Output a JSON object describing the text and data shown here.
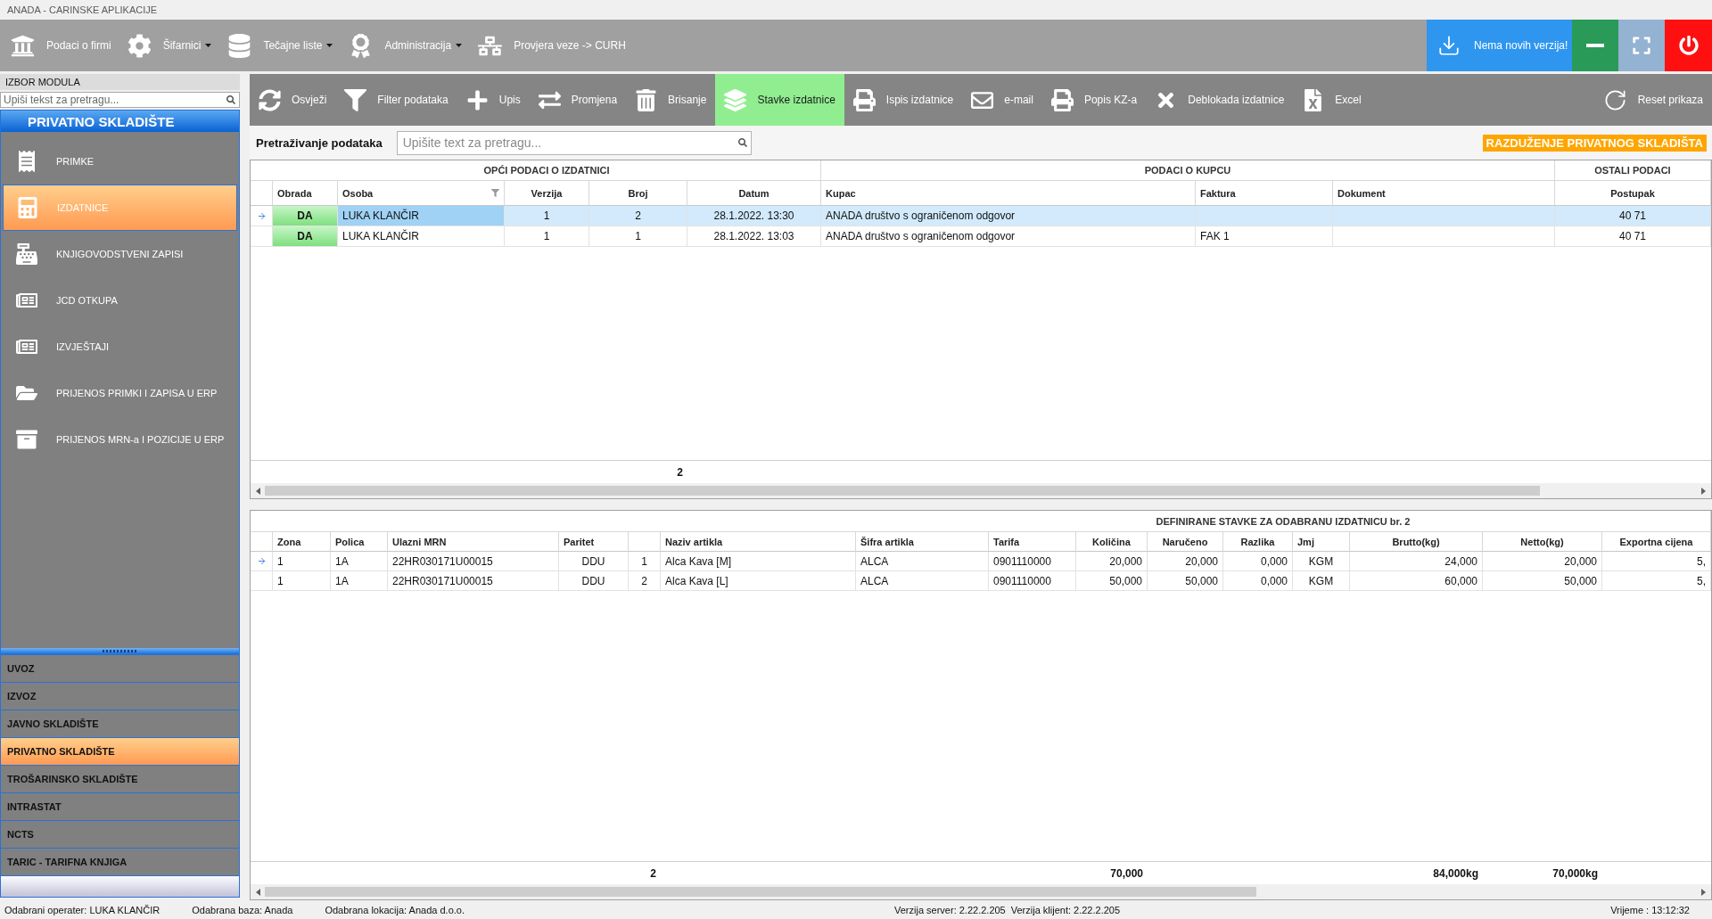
{
  "window": {
    "title": "ANADA - CARINSKE APLIKACIJE"
  },
  "menu_bar": {
    "items": [
      {
        "label": "Podaci o firmi",
        "dropdown": false
      },
      {
        "label": "Šifarnici",
        "dropdown": true
      },
      {
        "label": "Tečajne liste",
        "dropdown": true
      },
      {
        "label": "Administracija",
        "dropdown": true
      },
      {
        "label": "Provjera veze -> CURH",
        "dropdown": false
      }
    ],
    "update_button": {
      "label": "Nema novih verzija!"
    }
  },
  "sidebar": {
    "title": "IZBOR MODULA",
    "search": {
      "placeholder": "Upiši tekst za pretragu..."
    },
    "module_title": "PRIVATNO SKLADIŠTE",
    "items": [
      {
        "label": "PRIMKE",
        "selected": false
      },
      {
        "label": "IZDATNICE",
        "selected": true
      },
      {
        "label": "KNJIGOVODSTVENI ZAPISI",
        "selected": false
      },
      {
        "label": "JCD OTKUPA",
        "selected": false
      },
      {
        "label": "IZVJEŠTAJI",
        "selected": false
      },
      {
        "label": "PRIJENOS PRIMKI I ZAPISA U ERP",
        "selected": false
      },
      {
        "label": "PRIJENOS MRN-a I POZICIJE U ERP",
        "selected": false
      }
    ],
    "modules": [
      {
        "label": "UVOZ",
        "selected": false
      },
      {
        "label": "IZVOZ",
        "selected": false
      },
      {
        "label": "JAVNO SKLADIŠTE",
        "selected": false
      },
      {
        "label": "PRIVATNO SKLADIŠTE",
        "selected": true
      },
      {
        "label": "TROŠARINSKO SKLADIŠTE",
        "selected": false
      },
      {
        "label": "INTRASTAT",
        "selected": false
      },
      {
        "label": "NCTS",
        "selected": false
      },
      {
        "label": "TARIC - TARIFNA KNJIGA",
        "selected": false
      }
    ]
  },
  "toolbar": {
    "items": [
      {
        "label": "Osvježi",
        "selected": false
      },
      {
        "label": "Filter podataka",
        "selected": false
      },
      {
        "label": "Upis",
        "selected": false
      },
      {
        "label": "Promjena",
        "selected": false
      },
      {
        "label": "Brisanje",
        "selected": false
      },
      {
        "label": "Stavke izdatnice",
        "selected": true
      },
      {
        "label": "Ispis izdatnice",
        "selected": false
      },
      {
        "label": "e-mail",
        "selected": false
      },
      {
        "label": "Popis KZ-a",
        "selected": false
      },
      {
        "label": "Deblokada izdatnice",
        "selected": false
      },
      {
        "label": "Excel",
        "selected": false
      },
      {
        "label": "Reset prikaza",
        "selected": false
      }
    ]
  },
  "search": {
    "label": "Pretraživanje podataka",
    "placeholder": "Upišite text za pretragu..."
  },
  "mode_badge": "RAZDUŽENJE PRIVATNOG SKLADIŠTA",
  "issues_table": {
    "groups": [
      {
        "label": "OPĆI PODACI O IZDATNICI",
        "columns": [
          {
            "label": "Obrada",
            "kind": "status",
            "filter": false
          },
          {
            "label": "Osoba",
            "kind": "text",
            "filter": true
          },
          {
            "label": "Verzija",
            "kind": "text",
            "filter": false
          },
          {
            "label": "Broj",
            "kind": "text",
            "filter": false,
            "total": "2"
          },
          {
            "label": "Datum",
            "kind": "text",
            "filter": false
          }
        ]
      },
      {
        "label": "PODACI O KUPCU",
        "columns": [
          {
            "label": "Kupac",
            "kind": "text",
            "filter": false
          },
          {
            "label": "Faktura",
            "kind": "text",
            "filter": false
          },
          {
            "label": "Dokument",
            "kind": "text",
            "filter": false
          }
        ]
      },
      {
        "label": "OSTALI PODACI",
        "columns": [
          {
            "label": "Postupak",
            "kind": "text",
            "filter": false
          }
        ]
      }
    ],
    "rows": [
      {
        "selected": true,
        "cells": [
          "DA",
          "LUKA KLANČIR",
          "1",
          "2",
          "28.1.2022. 13:30",
          "ANADA društvo s ograničenom odgovor",
          null,
          null,
          "40 71"
        ]
      },
      {
        "selected": false,
        "cells": [
          "DA",
          "LUKA KLANČIR",
          "1",
          "1",
          "28.1.2022. 13:03",
          "ANADA društvo s ograničenom odgovor",
          "FAK 1",
          null,
          "40 71"
        ]
      }
    ]
  },
  "items_table": {
    "groups": [
      {
        "columns": [
          {
            "label": "Zona"
          },
          {
            "label": "Polica"
          },
          {
            "label": "Ulazni MRN"
          },
          {
            "label": "Paritet"
          },
          {
            "total": "2"
          },
          {
            "label": "Naziv artikla"
          }
        ]
      },
      {
        "label": "DEFINIRANE STAVKE ZA ODABRANU IZDATNICU br. 2",
        "columns": [
          {
            "label": "Šifra artikla"
          },
          {
            "label": "Tarifa"
          },
          {
            "label": "Količina",
            "total": "70,000"
          },
          {
            "label": "Naručeno"
          },
          {
            "label": "Razlika"
          },
          {
            "label": "Jmj"
          },
          {
            "label": "Brutto(kg)",
            "total": "84,000kg"
          },
          {
            "label": "Netto(kg)",
            "total": "70,000kg"
          },
          {
            "label": "Exportna cijena"
          }
        ]
      }
    ],
    "rows": [
      {
        "selected": true,
        "cells": [
          "1",
          "1A",
          "22HR030171U00015",
          "DDU",
          "1",
          "Alca Kava [M]",
          "ALCA",
          "0901110000",
          "20,000",
          "20,000",
          "0,000",
          "KGM",
          "24,000",
          "20,000",
          "5,"
        ]
      },
      {
        "selected": false,
        "cells": [
          "1",
          "1A",
          "22HR030171U00015",
          "DDU",
          "2",
          "Alca Kava [L]",
          "ALCA",
          "0901110000",
          "50,000",
          "50,000",
          "0,000",
          "KGM",
          "60,000",
          "50,000",
          "5,"
        ]
      }
    ]
  },
  "status_bar": {
    "operator": "Odabrani operater: LUKA KLANČIR",
    "database": "Odabrana baza: Anada",
    "location": "Odabrana lokacija: Anada d.o.o.",
    "server_version": "Verzija server: 2.22.2.205",
    "client_version": "Verzija klijent: 2.22.2.205",
    "time": "Vrijeme : 13:12:32"
  }
}
